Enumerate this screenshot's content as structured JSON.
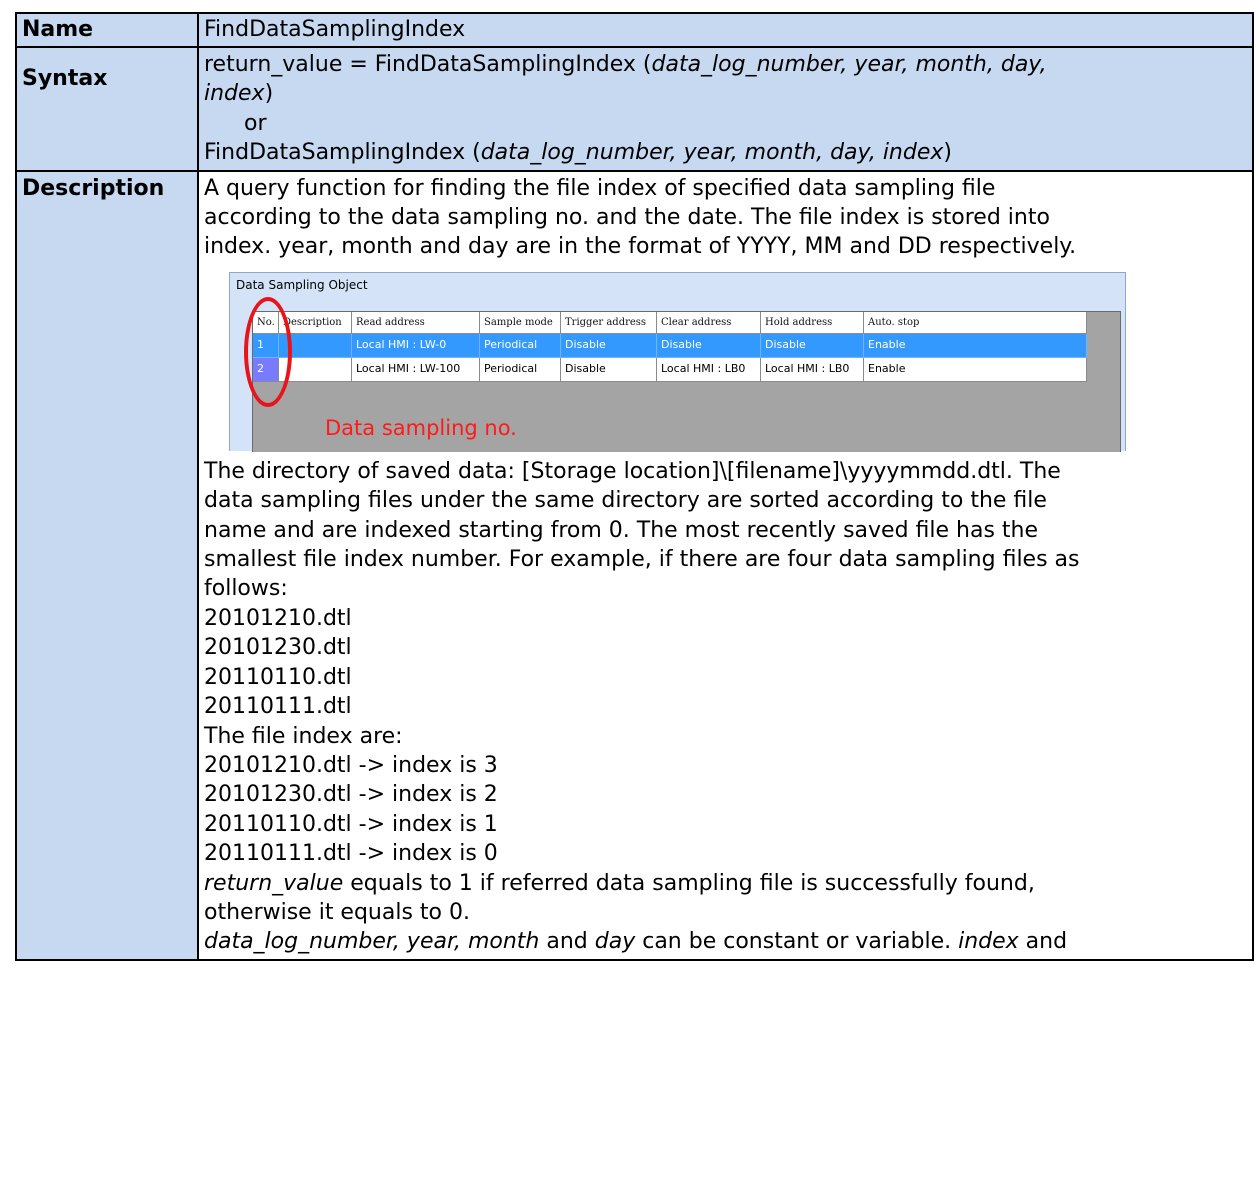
{
  "rows": {
    "name": {
      "label": "Name",
      "value": "FindDataSamplingIndex"
    },
    "syntax": {
      "label": "Syntax",
      "line1_pre": "return_value = FindDataSamplingIndex (",
      "line1_args": "data_log_number, year, month, day,",
      "line2_arg": "index",
      "line2_post": ")",
      "line3": "or",
      "line4_pre": "FindDataSamplingIndex (",
      "line4_args": "data_log_number, year, month, day, index",
      "line4_post": ")"
    },
    "description": {
      "label": "Description",
      "intro": [
        "A query function for finding the file index of specified data sampling file",
        "according to the data sampling no. and the date. The file index is stored into",
        "index. year, month and day are in the format of YYYY, MM and DD respectively."
      ],
      "paragraph": [
        "The directory of saved data: [Storage location]\\[filename]\\yyyymmdd.dtl. The",
        "data sampling files under the same directory are sorted according to the file",
        "name and are indexed starting from 0. The most recently saved file has the",
        "smallest file index number. For example, if there are four data sampling files as",
        "follows:"
      ],
      "files": [
        "20101210.dtl",
        "20101230.dtl",
        "20110110.dtl",
        "20110111.dtl"
      ],
      "index_heading": "The file index are:",
      "index_lines": [
        "20101210.dtl -> index is 3",
        "20101230.dtl -> index is 2",
        "20110110.dtl -> index is 1",
        "20110111.dtl -> index is 0"
      ],
      "return_em": "return_value",
      "return_rest": " equals to 1 if referred data sampling file is successfully found,",
      "return_line2": "otherwise it equals to 0.",
      "last_em1": "data_log_number, year, month",
      "last_mid1": " and ",
      "last_em2": "day",
      "last_mid2": " can be constant or variable. ",
      "last_em3": "index",
      "last_tail": " and"
    }
  },
  "dialog": {
    "title": "Data Sampling Object",
    "columns": [
      "No.",
      "Description",
      "Read address",
      "Sample mode",
      "Trigger address",
      "Clear address",
      "Hold address",
      "Auto. stop"
    ],
    "rows": [
      [
        "1",
        "",
        "Local HMI : LW-0",
        "Periodical",
        "Disable",
        "Disable",
        "Disable",
        "Enable"
      ],
      [
        "2",
        "",
        "Local HMI : LW-100",
        "Periodical",
        "Disable",
        "Local HMI : LB0",
        "Local HMI : LB0",
        "Enable"
      ]
    ],
    "selected_row": 0,
    "annotation": "Data sampling no.",
    "colors": {
      "selection": "#3399ff",
      "annotation": "#ff1a1a",
      "ring": "#e8141a",
      "header_cells": "#c6d9f1"
    }
  }
}
